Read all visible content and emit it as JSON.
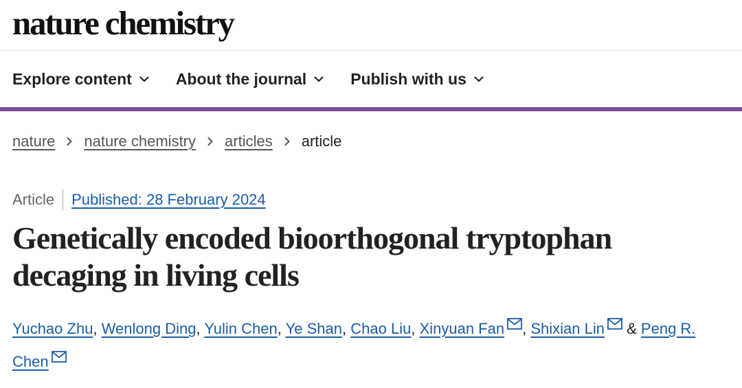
{
  "header": {
    "brand": "nature chemistry"
  },
  "nav": {
    "items": [
      {
        "label": "Explore content",
        "icon": "chevron-down-icon"
      },
      {
        "label": "About the journal",
        "icon": "chevron-down-icon"
      },
      {
        "label": "Publish with us",
        "icon": "chevron-down-icon"
      }
    ],
    "accent_color": "#7b4fa0"
  },
  "breadcrumb": {
    "items": [
      "nature",
      "nature chemistry",
      "articles",
      "article"
    ],
    "separator_icon": "chevron-right-icon"
  },
  "article": {
    "type": "Article",
    "published": "Published: 28 February 2024",
    "title_line1": "Genetically encoded bioorthogonal tryptophan",
    "title_line2": "decaging in living cells",
    "link_color": "#1a5da6",
    "authors": [
      {
        "name": "Yuchao Zhu"
      },
      {
        "name": "Wenlong Ding"
      },
      {
        "name": "Yulin Chen"
      },
      {
        "name": "Ye Shan"
      },
      {
        "name": "Chao Liu"
      },
      {
        "name": "Xinyuan Fan",
        "contact_icon": "mail-icon"
      },
      {
        "name": "Shixian Lin",
        "contact_icon": "mail-icon"
      },
      {
        "name_part1": "Peng R.",
        "name_part2": "Chen",
        "contact_icon": "mail-icon"
      }
    ],
    "author_separator": ",",
    "author_conjunction": "&"
  }
}
